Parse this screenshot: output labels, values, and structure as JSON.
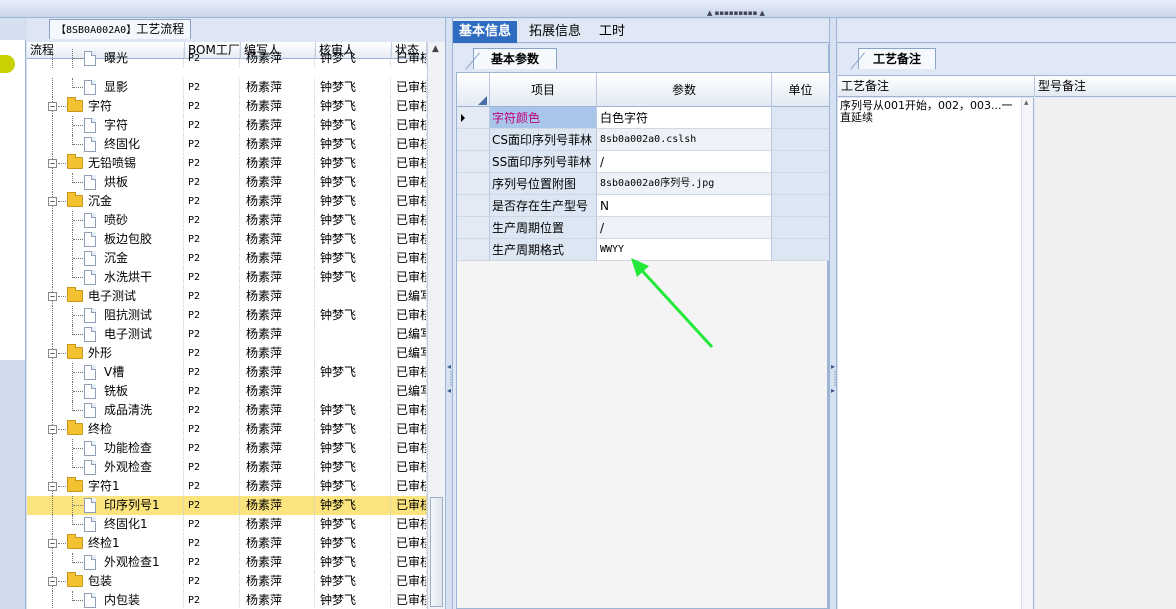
{
  "left_panel": {
    "tab_code": "【8SB0A002A0】",
    "tab_title": "工艺流程",
    "columns": [
      "流程",
      "BOM工厂",
      "编写人",
      "核审人",
      "状态"
    ],
    "rows": [
      {
        "level": 2,
        "type": "step",
        "name": "曝光",
        "bom": "P2",
        "writer": "杨素萍",
        "reviewer": "钟梦飞",
        "status": "已审核",
        "clipped": true
      },
      {
        "level": 2,
        "type": "step",
        "name": "显影",
        "bom": "P2",
        "writer": "杨素萍",
        "reviewer": "钟梦飞",
        "status": "已审核"
      },
      {
        "level": 1,
        "type": "folder",
        "name": "字符",
        "bom": "P2",
        "writer": "杨素萍",
        "reviewer": "钟梦飞",
        "status": "已审核"
      },
      {
        "level": 2,
        "type": "step",
        "name": "字符",
        "bom": "P2",
        "writer": "杨素萍",
        "reviewer": "钟梦飞",
        "status": "已审核"
      },
      {
        "level": 2,
        "type": "step",
        "name": "终固化",
        "bom": "P2",
        "writer": "杨素萍",
        "reviewer": "钟梦飞",
        "status": "已审核"
      },
      {
        "level": 1,
        "type": "folder",
        "name": "无铅喷锡",
        "bom": "P2",
        "writer": "杨素萍",
        "reviewer": "钟梦飞",
        "status": "已审核"
      },
      {
        "level": 2,
        "type": "step",
        "name": "烘板",
        "bom": "P2",
        "writer": "杨素萍",
        "reviewer": "钟梦飞",
        "status": "已审核"
      },
      {
        "level": 1,
        "type": "folder",
        "name": "沉金",
        "bom": "P2",
        "writer": "杨素萍",
        "reviewer": "钟梦飞",
        "status": "已审核"
      },
      {
        "level": 2,
        "type": "step",
        "name": "喷砂",
        "bom": "P2",
        "writer": "杨素萍",
        "reviewer": "钟梦飞",
        "status": "已审核"
      },
      {
        "level": 2,
        "type": "step",
        "name": "板边包胶",
        "bom": "P2",
        "writer": "杨素萍",
        "reviewer": "钟梦飞",
        "status": "已审核"
      },
      {
        "level": 2,
        "type": "step",
        "name": "沉金",
        "bom": "P2",
        "writer": "杨素萍",
        "reviewer": "钟梦飞",
        "status": "已审核"
      },
      {
        "level": 2,
        "type": "step",
        "name": "水洗烘干",
        "bom": "P2",
        "writer": "杨素萍",
        "reviewer": "钟梦飞",
        "status": "已审核"
      },
      {
        "level": 1,
        "type": "folder",
        "name": "电子测试",
        "bom": "P2",
        "writer": "杨素萍",
        "reviewer": "",
        "status": "已编写"
      },
      {
        "level": 2,
        "type": "step",
        "name": "阻抗测试",
        "bom": "P2",
        "writer": "杨素萍",
        "reviewer": "钟梦飞",
        "status": "已审核"
      },
      {
        "level": 2,
        "type": "step",
        "name": "电子测试",
        "bom": "P2",
        "writer": "杨素萍",
        "reviewer": "",
        "status": "已编写"
      },
      {
        "level": 1,
        "type": "folder",
        "name": "外形",
        "bom": "P2",
        "writer": "杨素萍",
        "reviewer": "",
        "status": "已编写"
      },
      {
        "level": 2,
        "type": "step",
        "name": "V槽",
        "bom": "P2",
        "writer": "杨素萍",
        "reviewer": "钟梦飞",
        "status": "已审核"
      },
      {
        "level": 2,
        "type": "step",
        "name": "铣板",
        "bom": "P2",
        "writer": "杨素萍",
        "reviewer": "",
        "status": "已编写"
      },
      {
        "level": 2,
        "type": "step",
        "name": "成品清洗",
        "bom": "P2",
        "writer": "杨素萍",
        "reviewer": "钟梦飞",
        "status": "已审核"
      },
      {
        "level": 1,
        "type": "folder",
        "name": "终检",
        "bom": "P2",
        "writer": "杨素萍",
        "reviewer": "钟梦飞",
        "status": "已审核"
      },
      {
        "level": 2,
        "type": "step",
        "name": "功能检查",
        "bom": "P2",
        "writer": "杨素萍",
        "reviewer": "钟梦飞",
        "status": "已审核"
      },
      {
        "level": 2,
        "type": "step",
        "name": "外观检查",
        "bom": "P2",
        "writer": "杨素萍",
        "reviewer": "钟梦飞",
        "status": "已审核"
      },
      {
        "level": 1,
        "type": "folder",
        "name": "字符1",
        "bom": "P2",
        "writer": "杨素萍",
        "reviewer": "钟梦飞",
        "status": "已审核"
      },
      {
        "level": 2,
        "type": "step",
        "name": "印序列号1",
        "bom": "P2",
        "writer": "杨素萍",
        "reviewer": "钟梦飞",
        "status": "已审核",
        "selected": true
      },
      {
        "level": 2,
        "type": "step",
        "name": "终固化1",
        "bom": "P2",
        "writer": "杨素萍",
        "reviewer": "钟梦飞",
        "status": "已审核"
      },
      {
        "level": 1,
        "type": "folder",
        "name": "终检1",
        "bom": "P2",
        "writer": "杨素萍",
        "reviewer": "钟梦飞",
        "status": "已审核"
      },
      {
        "level": 2,
        "type": "step",
        "name": "外观检查1",
        "bom": "P2",
        "writer": "杨素萍",
        "reviewer": "钟梦飞",
        "status": "已审核"
      },
      {
        "level": 1,
        "type": "folder",
        "name": "包装",
        "bom": "P2",
        "writer": "杨素萍",
        "reviewer": "钟梦飞",
        "status": "已审核"
      },
      {
        "level": 2,
        "type": "step",
        "name": "内包装",
        "bom": "P2",
        "writer": "杨素萍",
        "reviewer": "钟梦飞",
        "status": "已审核"
      }
    ]
  },
  "main_tabs": [
    "基本信息",
    "拓展信息",
    "工时"
  ],
  "basic_params": {
    "tab_label": "基本参数",
    "columns": {
      "item": "项目",
      "param": "参数",
      "unit": "单位"
    },
    "rows": [
      {
        "item": "字符颜色",
        "param": "白色字符",
        "unit": "",
        "highlight": true
      },
      {
        "item": "CS面印序列号菲林",
        "param": "8sb0a002a0.cslsh",
        "unit": ""
      },
      {
        "item": "SS面印序列号菲林",
        "param": "/",
        "unit": ""
      },
      {
        "item": "序列号位置附图",
        "param": "8sb0a002a0序列号.jpg",
        "unit": ""
      },
      {
        "item": "是否存在生产型号",
        "param": "N",
        "unit": ""
      },
      {
        "item": "生产周期位置",
        "param": "/",
        "unit": ""
      },
      {
        "item": "生产周期格式",
        "param": "WWYY",
        "unit": ""
      }
    ]
  },
  "notes": {
    "tab_label": "工艺备注",
    "col_process_note": "工艺备注",
    "col_model_note": "型号备注",
    "process_note_text": "序列号从001开始，002，003...一直延续"
  },
  "colors": {
    "accent": "#2f6cc0",
    "selected_row": "#fbe37e",
    "annotation_arrow": "#22e83a"
  }
}
